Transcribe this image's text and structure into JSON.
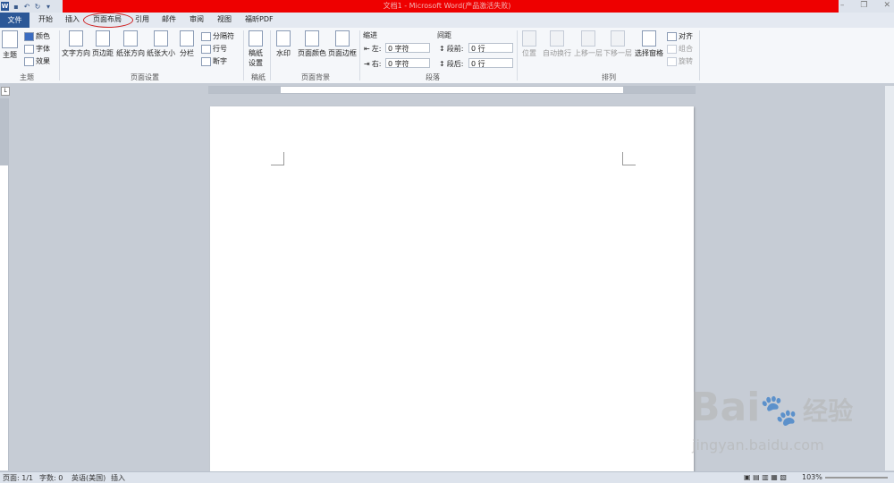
{
  "window": {
    "title": "文档1 - Microsoft Word(产品激活失败)",
    "app_icon": "W"
  },
  "quick_access": [
    "save-icon",
    "undo-icon",
    "redo-icon",
    "customize-icon"
  ],
  "tabs": {
    "file": "文件",
    "items": [
      "开始",
      "插入",
      "页面布局",
      "引用",
      "邮件",
      "审阅",
      "视图",
      "福昕PDF"
    ],
    "active": "页面布局"
  },
  "ribbon": {
    "theme": {
      "label": "主题",
      "big": "主题",
      "colors": "颜色",
      "fonts": "字体",
      "effects": "效果"
    },
    "page_setup": {
      "label": "页面设置",
      "text_dir": "文字方向",
      "margins": "页边距",
      "orientation": "纸张方向",
      "size": "纸张大小",
      "columns": "分栏",
      "breaks": "分隔符",
      "line_numbers": "行号",
      "hyphenation": "断字"
    },
    "draft": {
      "label": "稿纸",
      "btn1": "稿纸",
      "btn2": "设置"
    },
    "page_bg": {
      "label": "页面背景",
      "watermark": "水印",
      "page_color": "页面颜色",
      "page_borders": "页面边框"
    },
    "paragraph": {
      "label": "段落",
      "indent": "缩进",
      "spacing": "间距",
      "left_label": "左:",
      "right_label": "右:",
      "before_label": "段前:",
      "after_label": "段后:",
      "left_val": "0 字符",
      "right_val": "0 字符",
      "before_val": "0 行",
      "after_val": "0 行"
    },
    "arrange": {
      "label": "排列",
      "position": "位置",
      "wrap": "自动换行",
      "forward": "上移一层",
      "backward": "下移一层",
      "selection": "选择窗格",
      "align": "对齐",
      "group": "组合",
      "rotate": "旋转"
    }
  },
  "status": {
    "page": "页面: 1/1",
    "words": "字数: 0",
    "lang": "英语(美国)",
    "mode": "插入",
    "zoom": "103%"
  },
  "watermark": {
    "brand": "Bai",
    "brand2": "经验",
    "url": "jingyan.baidu.com"
  }
}
